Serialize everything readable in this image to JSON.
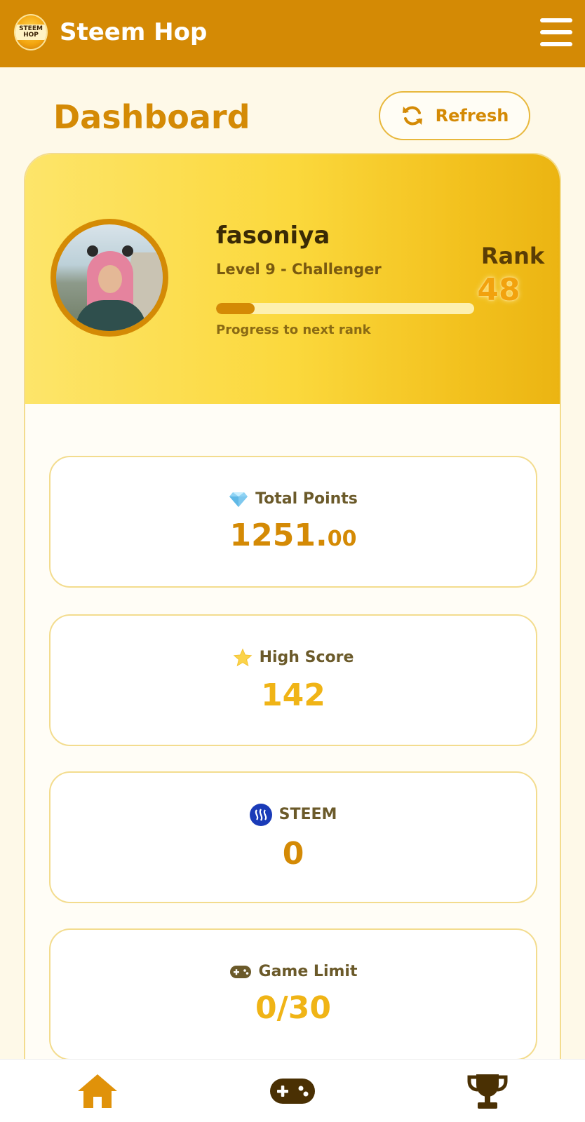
{
  "header": {
    "logo_text": "STEEM HOP",
    "app_title": "Steem Hop",
    "menu_icon": "hamburger-menu-icon"
  },
  "page": {
    "title": "Dashboard",
    "refresh_label": "Refresh",
    "refresh_icon": "refresh-icon"
  },
  "profile": {
    "username": "fasoniya",
    "level": "Level 9 - Challenger",
    "progress_fraction": 0.15,
    "progress_label": "Progress to next rank",
    "rank_label": "Rank",
    "rank_value": "48"
  },
  "stats": [
    {
      "icon": "gem-icon",
      "label": "Total Points",
      "value": "1251.",
      "value_decimal": "00"
    },
    {
      "icon": "star-icon",
      "label": "High Score",
      "value": "142"
    },
    {
      "icon": "steem-icon",
      "label": "STEEM",
      "value": "0"
    },
    {
      "icon": "gamepad-icon",
      "label": "Game Limit",
      "value": "0/30"
    }
  ],
  "bottom_nav": [
    {
      "icon": "home-icon"
    },
    {
      "icon": "gamepad-icon"
    },
    {
      "icon": "trophy-icon"
    }
  ],
  "colors": {
    "header": "#d48a05",
    "accent": "#d48a05",
    "gold": "#f0b416",
    "background": "#fef9e8"
  }
}
